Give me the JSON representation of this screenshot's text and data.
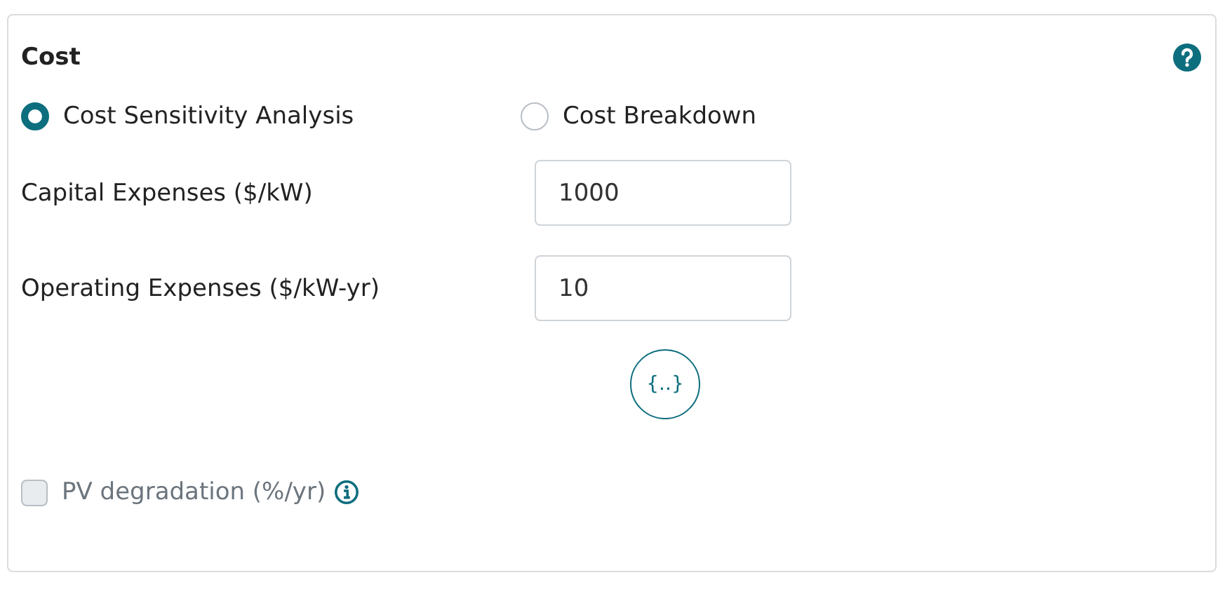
{
  "panel": {
    "title": "Cost"
  },
  "options": [
    {
      "label": "Cost Sensitivity Analysis",
      "selected": true
    },
    {
      "label": "Cost Breakdown",
      "selected": false
    }
  ],
  "fields": [
    {
      "label": "Capital Expenses ($/kW)",
      "value": "1000"
    },
    {
      "label": "Operating Expenses ($/kW-yr)",
      "value": "10"
    }
  ],
  "expression_button": "{..}",
  "degradation": {
    "label": "PV degradation (%/yr)",
    "checked": false,
    "disabled": true
  }
}
